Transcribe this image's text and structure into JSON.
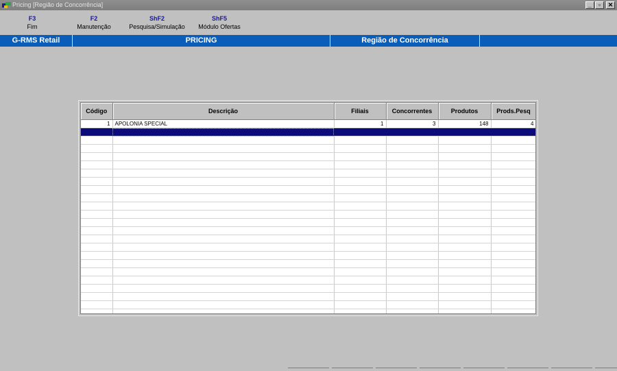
{
  "window": {
    "title": "Pricing  [Região de Concorrência]",
    "controls": {
      "minimize": "_",
      "maximize": "▫",
      "close": "✕"
    }
  },
  "toolbar": [
    {
      "key": "F3",
      "label": "Fim"
    },
    {
      "key": "F2",
      "label": "Manutenção"
    },
    {
      "key": "ShF2",
      "label": "Pesquisa/Simulação"
    },
    {
      "key": "ShF5",
      "label": "Módulo Ofertas"
    }
  ],
  "header": {
    "app": "G-RMS Retail",
    "module": "PRICING",
    "screen": "Região de Concorrência"
  },
  "colors": {
    "header_blue": "#0a5db8",
    "selection_navy": "#0c0c7a",
    "title_gray": "#808080"
  },
  "grid": {
    "columns": [
      "Código",
      "Descrição",
      "Filiais",
      "Concorrentes",
      "Produtos",
      "Prods.Pesq"
    ],
    "rows": [
      {
        "codigo": "1",
        "descricao": "APOLONIA SPECIAL",
        "filiais": "1",
        "concorrentes": "3",
        "produtos": "148",
        "prods_pesq": "4"
      }
    ]
  }
}
